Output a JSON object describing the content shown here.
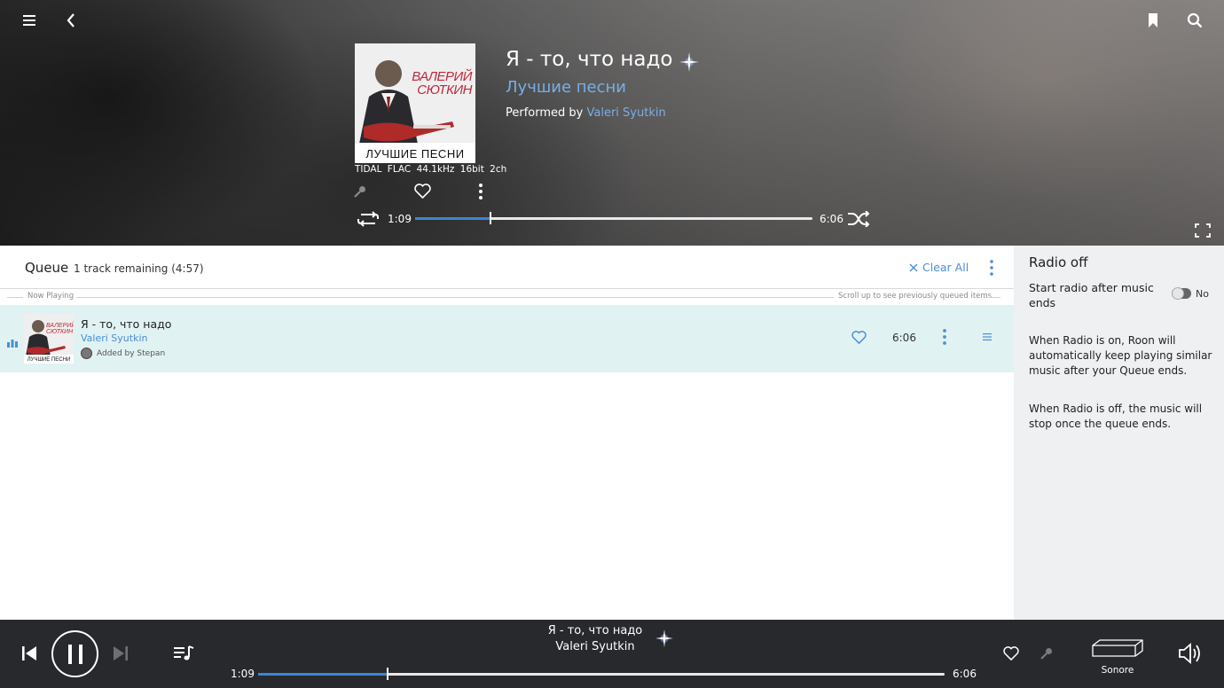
{
  "now_playing": {
    "track_title": "Я - то, что надо",
    "album_title": "Лучшие песни",
    "performed_by_label": "Performed by",
    "artist": "Valeri Syutkin",
    "quality": "TIDAL  FLAC  44.1kHz  16bit  2ch",
    "album_art_text_top": "ВАЛЕРИЙ СЮТКИН",
    "album_art_text_bottom": "ЛУЧШИЕ ПЕСНИ",
    "elapsed": "1:09",
    "duration": "6:06",
    "progress_fraction": 0.189
  },
  "queue": {
    "title": "Queue",
    "count_text": "1 track remaining (4:57)",
    "clear_all_label": "Clear All",
    "now_playing_label": "Now Playing",
    "scroll_hint": "Scroll up to see previously queued items",
    "items": [
      {
        "title": "Я - то, что надо",
        "artist": "Valeri Syutkin",
        "added_by": "Added by Stepan",
        "duration": "6:06",
        "art_text_top": "ВАЛЕРИЙ СЮТКИН",
        "art_text_bottom": "ЛУЧШИЕ ПЕСНИ"
      }
    ]
  },
  "radio": {
    "title": "Radio off",
    "start_label": "Start radio after music ends",
    "toggle_label": "No",
    "desc_on": "When Radio is on, Roon will automatically keep playing similar music after your Queue ends.",
    "desc_off": "When Radio is off, the music will stop once the queue ends."
  },
  "bottom_bar": {
    "title": "Я - то, что надо",
    "artist": "Valeri Syutkin",
    "elapsed": "1:09",
    "duration": "6:06",
    "progress_fraction": 0.189,
    "zone_name": "Sonore"
  },
  "colors": {
    "accent": "#3b86d6",
    "link": "#78aee6",
    "queue_row_highlight": "#e1f2f3",
    "bottom_bar": "#27292c",
    "radio_panel": "#eef0f2"
  },
  "icons": {
    "menu": "hamburger-icon",
    "back": "back-chevron-icon",
    "bookmark": "bookmark-icon",
    "search": "search-icon",
    "sparkle": "sparkle-icon",
    "mic": "microphone-icon",
    "heart": "heart-icon",
    "more": "more-vertical-icon",
    "repeat": "repeat-icon",
    "shuffle": "shuffle-icon",
    "fullscreen": "fullscreen-icon",
    "clear": "close-icon",
    "drag": "drag-handle-icon",
    "previous": "skip-previous-icon",
    "pause": "pause-icon",
    "next": "skip-next-icon",
    "queue": "queue-music-icon",
    "device": "streamer-device-icon",
    "volume": "volume-icon"
  }
}
